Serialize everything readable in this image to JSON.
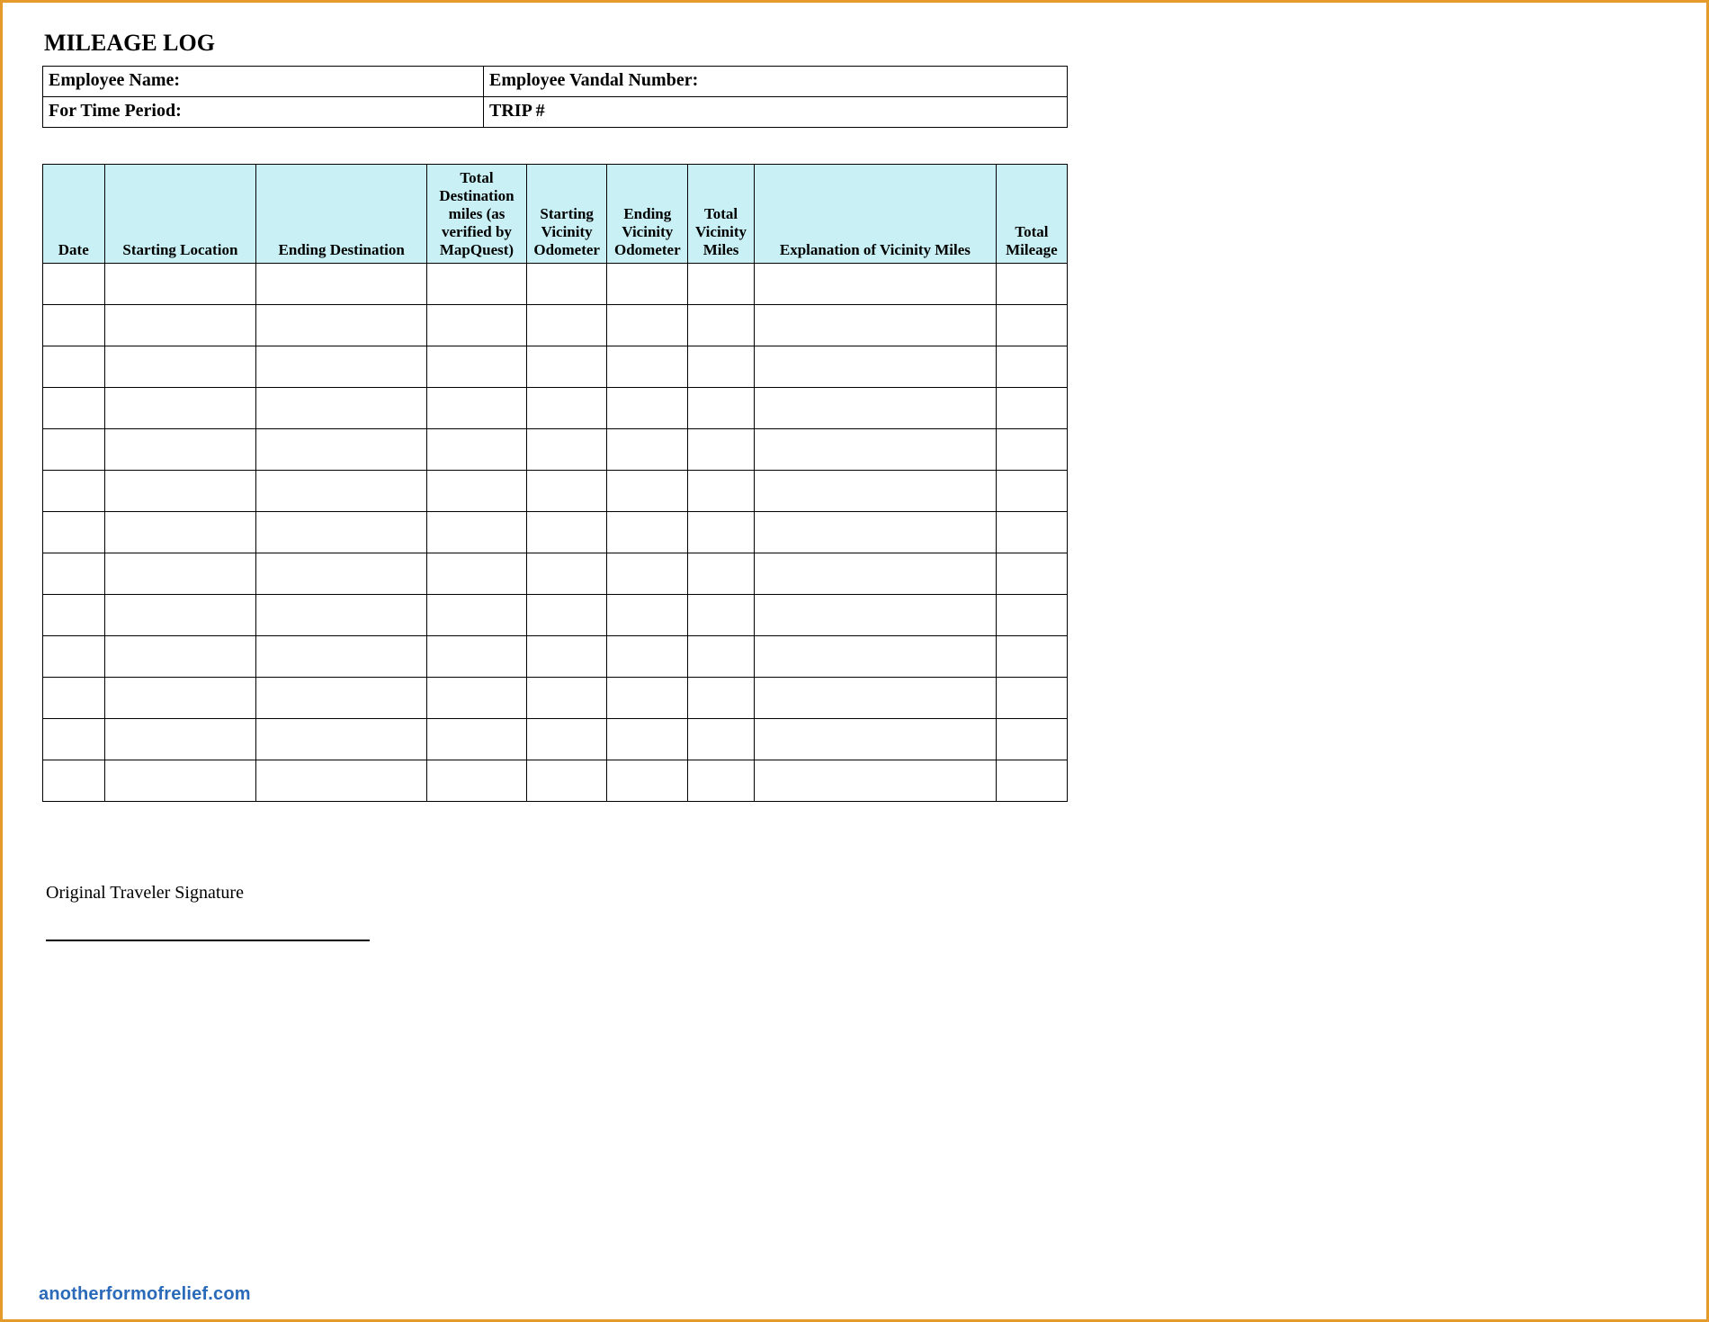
{
  "title": "MILEAGE LOG",
  "info": {
    "employee_name_label": "Employee Name:",
    "employee_vandal_label": "Employee Vandal Number:",
    "time_period_label": "For Time Period:",
    "trip_label": "TRIP #"
  },
  "columns": {
    "date": "Date",
    "starting_location": "Starting Location",
    "ending_destination": "Ending Destination",
    "total_dest_miles": "Total Destination miles (as verified by MapQuest)",
    "starting_vicinity_odo": "Starting Vicinity Odometer",
    "ending_vicinity_odo": "Ending Vicinity Odometer",
    "total_vicinity_miles": "Total Vicinity Miles",
    "explanation": "Explanation of Vicinity Miles",
    "total_mileage": "Total Mileage"
  },
  "empty_row_count": 13,
  "signature_label": "Original Traveler Signature",
  "watermark": "anotherformofrelief.com"
}
